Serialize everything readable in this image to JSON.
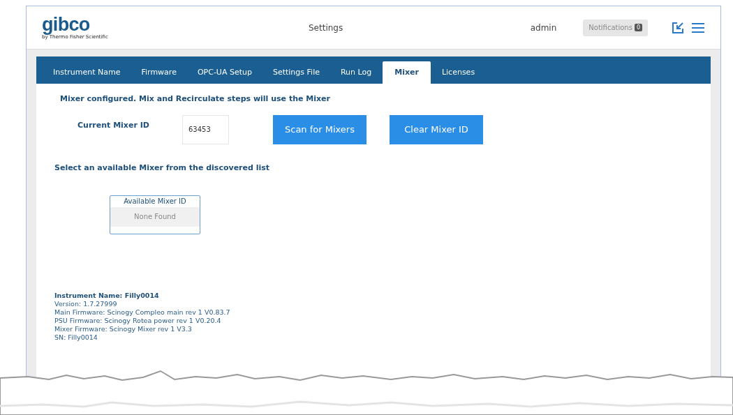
{
  "header": {
    "logo": "gibco",
    "logo_tagline": "by Thermo Fisher Scientific",
    "title": "Settings",
    "user": "admin",
    "notifications": {
      "label": "Notifications",
      "count": "0",
      "disabled": true
    }
  },
  "tabs": [
    {
      "label": "Instrument Name",
      "selected": false
    },
    {
      "label": "Firmware",
      "selected": false
    },
    {
      "label": "OPC-UA Setup",
      "selected": false
    },
    {
      "label": "Settings File",
      "selected": false
    },
    {
      "label": "Run Log",
      "selected": false
    },
    {
      "label": "Mixer",
      "selected": true
    },
    {
      "label": "Licenses",
      "selected": false
    }
  ],
  "status_message": "Mixer configured. Mix and Recirculate steps will use the Mixer",
  "current_mixer": {
    "label": "Current Mixer ID",
    "value": "63453"
  },
  "buttons": [
    "Scan for Mixers",
    "Clear Mixer ID"
  ],
  "select_prompt": "Select an available Mixer from the discovered list",
  "mixer_table": {
    "columns": [
      "Available Mixer ID"
    ],
    "rows": [
      [
        "None Found"
      ]
    ]
  },
  "info": {
    "title": "Instrument Name: Filly0014",
    "lines": [
      "Version: 1.7.27999",
      "Main Firmware: Scinogy Compleo main rev 1 V0.83.7",
      "PSU Firmware: Scinogy Rotea power rev 1 V0.20.4",
      "Mixer Firmware: Scinogy Mixer rev 1 V3.3",
      "SN: Filly0014"
    ]
  }
}
